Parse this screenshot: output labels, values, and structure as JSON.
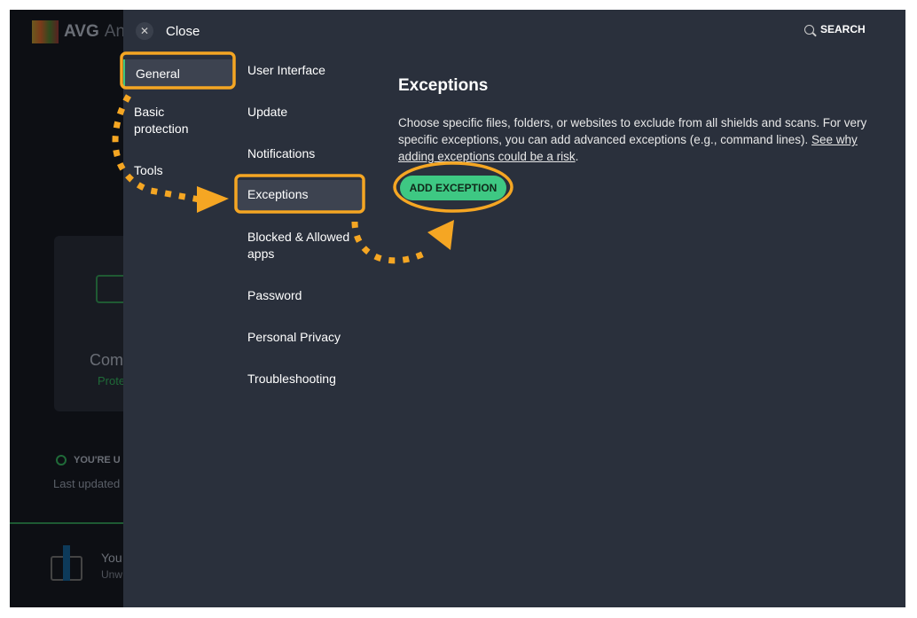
{
  "background_app": {
    "logo_text": "AVG",
    "app_name_partial": "Ant",
    "card_title": "Com",
    "card_status": "Prote",
    "update_status": "YOU'RE U",
    "last_updated": "Last updated",
    "promo_title": "You",
    "promo_sub": "Unw"
  },
  "header": {
    "close_label": "Close",
    "search_label": "SEARCH"
  },
  "categories": [
    {
      "label": "General",
      "selected": true
    },
    {
      "label": "Basic protection"
    },
    {
      "label": "Tools"
    }
  ],
  "subsections": [
    {
      "label": "User Interface"
    },
    {
      "label": "Update"
    },
    {
      "label": "Notifications"
    },
    {
      "label": "Exceptions",
      "selected": true
    },
    {
      "label": "Blocked & Allowed apps"
    },
    {
      "label": "Password"
    },
    {
      "label": "Personal Privacy"
    },
    {
      "label": "Troubleshooting"
    }
  ],
  "content": {
    "title": "Exceptions",
    "description": "Choose specific files, folders, or websites to exclude from all shields and scans. For very specific exceptions, you can add advanced exceptions (e.g., command lines).",
    "link": "See why adding exceptions could be a risk",
    "link_suffix": ".",
    "button": "ADD EXCEPTION"
  },
  "colors": {
    "accent": "#3ec883",
    "annotation": "#f5a623",
    "panel": "#2a303c"
  }
}
